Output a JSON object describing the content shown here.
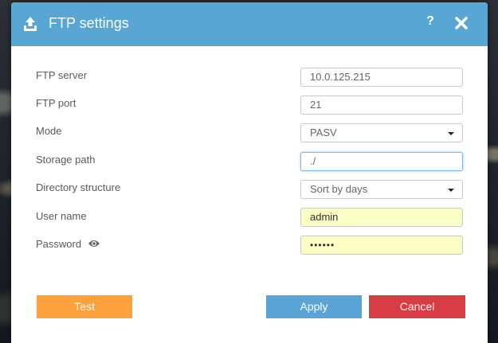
{
  "dialog": {
    "title": "FTP settings",
    "help_label": "?",
    "icons": {
      "title": "upload-icon",
      "close": "close-icon",
      "password_reveal": "eye-icon"
    },
    "colors": {
      "header": "#57a6d4",
      "test": "#fca13c",
      "apply": "#5aa5d6",
      "cancel": "#d83d45",
      "autofill": "#fafdc4"
    }
  },
  "form": {
    "server": {
      "label": "FTP server",
      "value": "10.0.125.215"
    },
    "port": {
      "label": "FTP port",
      "value": "21"
    },
    "mode": {
      "label": "Mode",
      "value": "PASV"
    },
    "storage_path": {
      "label": "Storage path",
      "value": "./"
    },
    "directory_structure": {
      "label": "Directory structure",
      "value": "Sort by days"
    },
    "user_name": {
      "label": "User name",
      "value": "admin"
    },
    "password": {
      "label": "Password",
      "value": "••••••"
    }
  },
  "buttons": {
    "test": "Test",
    "apply": "Apply",
    "cancel": "Cancel"
  }
}
